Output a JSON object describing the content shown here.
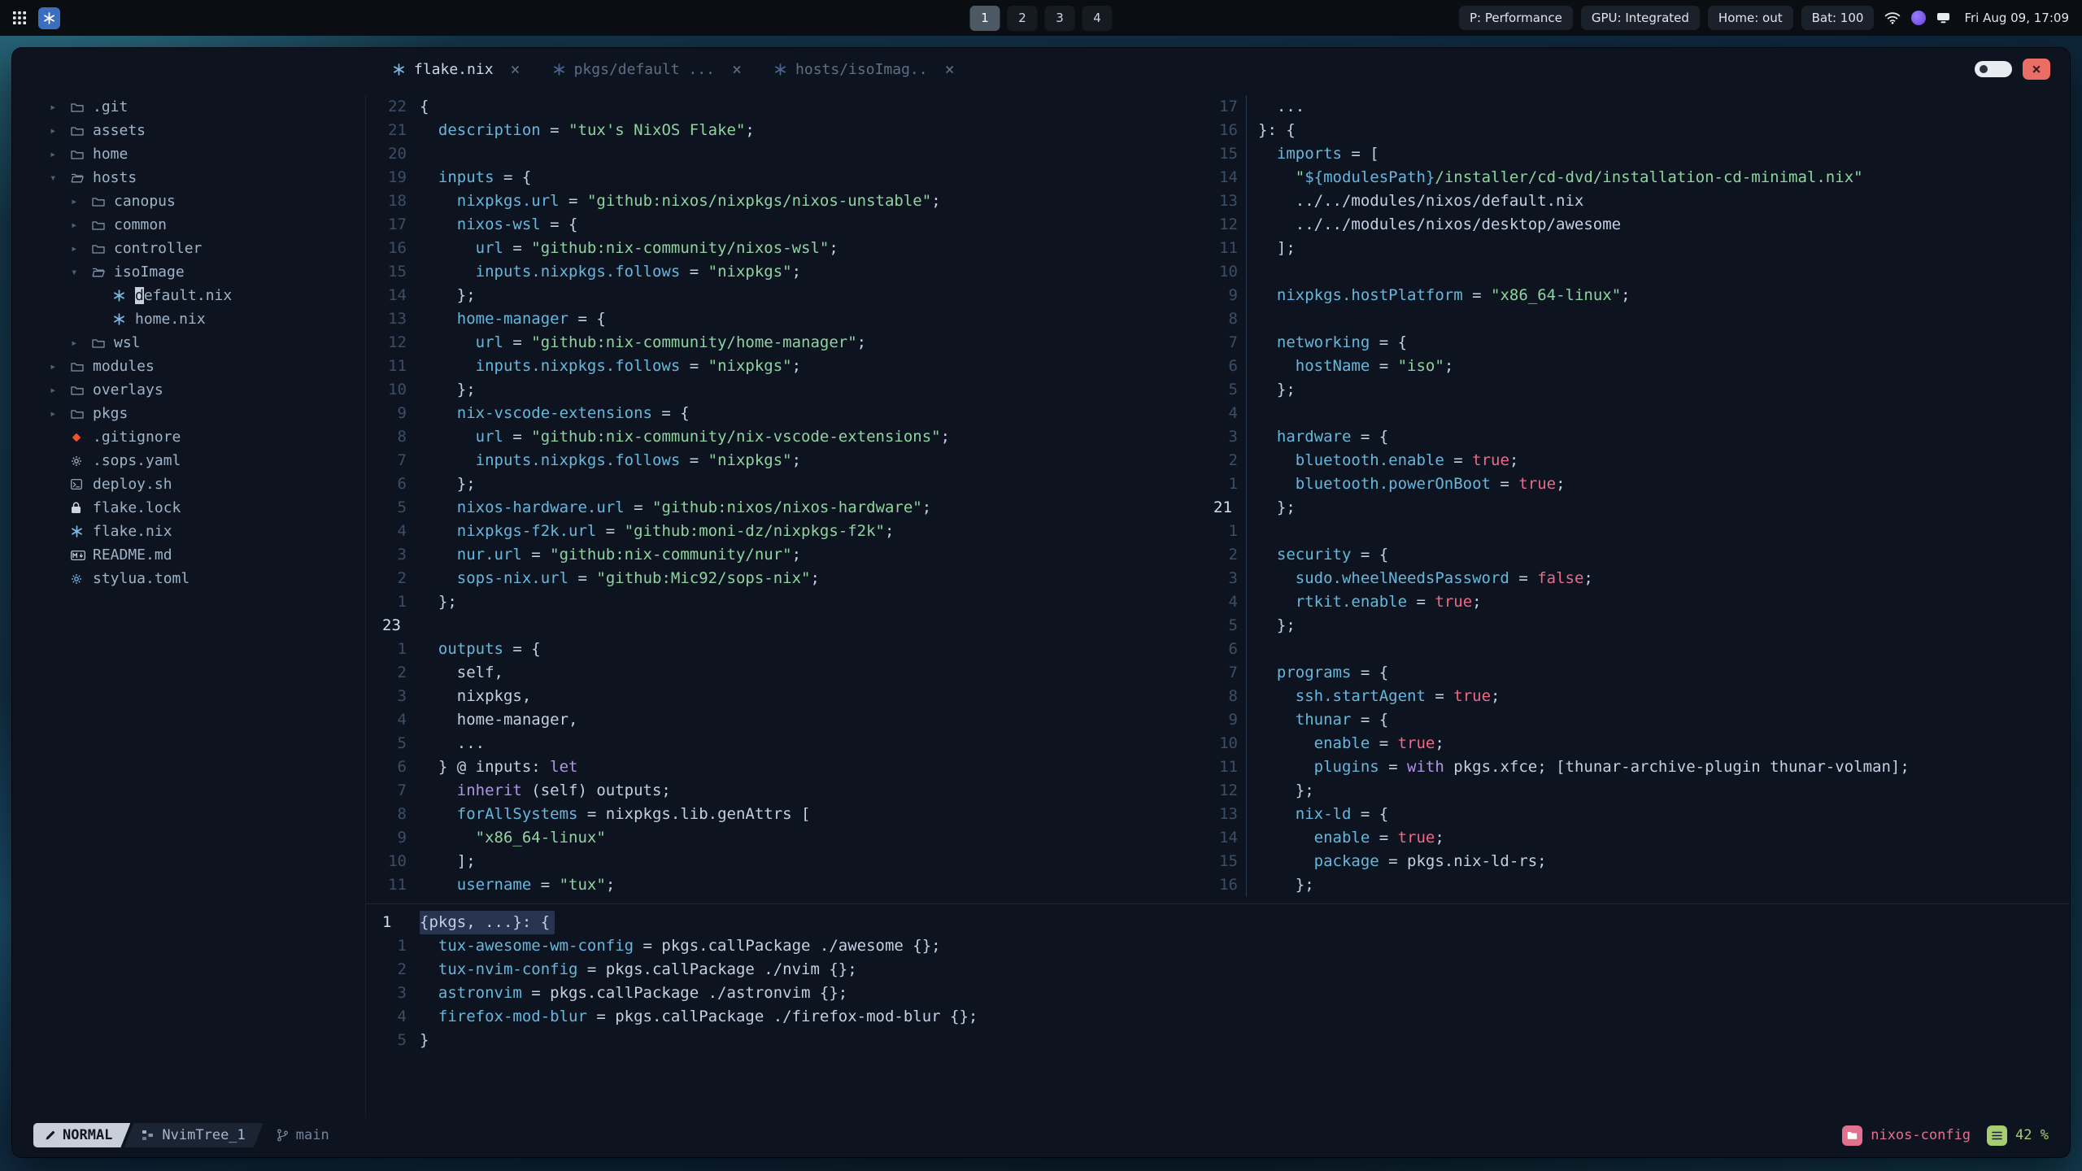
{
  "icons": {
    "chevron_right": "▸",
    "chevron_down": "▾",
    "close": "×"
  },
  "topbar": {
    "workspaces": {
      "items": [
        "1",
        "2",
        "3",
        "4"
      ],
      "active": "1"
    },
    "status_pills": [
      "P: Performance",
      "GPU: Integrated",
      "Home: out",
      "Bat: 100"
    ],
    "clock": "Fri Aug 09, 17:09"
  },
  "window": {
    "tabs": [
      {
        "label": "flake.nix",
        "active": true
      },
      {
        "label": "pkgs/default ...",
        "active": false
      },
      {
        "label": "hosts/isoImag..",
        "active": false
      }
    ],
    "tree": {
      "items": [
        {
          "depth": 0,
          "chevron": "right",
          "icon": "folder",
          "label": ".git"
        },
        {
          "depth": 0,
          "chevron": "right",
          "icon": "folder",
          "label": "assets"
        },
        {
          "depth": 0,
          "chevron": "right",
          "icon": "folder",
          "label": "home"
        },
        {
          "depth": 0,
          "chevron": "down",
          "icon": "folder-open",
          "label": "hosts"
        },
        {
          "depth": 1,
          "chevron": "right",
          "icon": "folder",
          "label": "canopus"
        },
        {
          "depth": 1,
          "chevron": "right",
          "icon": "folder",
          "label": "common"
        },
        {
          "depth": 1,
          "chevron": "right",
          "icon": "folder",
          "label": "controller"
        },
        {
          "depth": 1,
          "chevron": "down",
          "icon": "folder-open",
          "label": "isoImage"
        },
        {
          "depth": 2,
          "chevron": null,
          "icon": "nix",
          "label": "default.nix",
          "cursor": true
        },
        {
          "depth": 2,
          "chevron": null,
          "icon": "nix",
          "label": "home.nix"
        },
        {
          "depth": 1,
          "chevron": "right",
          "icon": "folder",
          "label": "wsl"
        },
        {
          "depth": 0,
          "chevron": "right",
          "icon": "folder",
          "label": "modules"
        },
        {
          "depth": 0,
          "chevron": "right",
          "icon": "folder",
          "label": "overlays"
        },
        {
          "depth": 0,
          "chevron": "right",
          "icon": "folder",
          "label": "pkgs"
        },
        {
          "depth": 0,
          "chevron": null,
          "icon": "git",
          "label": ".gitignore"
        },
        {
          "depth": 0,
          "chevron": null,
          "icon": "gear",
          "label": ".sops.yaml"
        },
        {
          "depth": 0,
          "chevron": null,
          "icon": "shell",
          "label": "deploy.sh"
        },
        {
          "depth": 0,
          "chevron": null,
          "icon": "lock",
          "label": "flake.lock"
        },
        {
          "depth": 0,
          "chevron": null,
          "icon": "nix",
          "label": "flake.nix"
        },
        {
          "depth": 0,
          "chevron": null,
          "icon": "markdown",
          "label": "README.md"
        },
        {
          "depth": 0,
          "chevron": null,
          "icon": "gear-blue",
          "label": "stylua.toml"
        }
      ]
    },
    "panes": {
      "flake": [
        {
          "n": "22",
          "t": "{"
        },
        {
          "n": "21",
          "t": "  description = \"tux's NixOS Flake\";"
        },
        {
          "n": "20",
          "t": ""
        },
        {
          "n": "19",
          "t": "  inputs = {"
        },
        {
          "n": "18",
          "t": "    nixpkgs.url = \"github:nixos/nixpkgs/nixos-unstable\";"
        },
        {
          "n": "17",
          "t": "    nixos-wsl = {"
        },
        {
          "n": "16",
          "t": "      url = \"github:nix-community/nixos-wsl\";"
        },
        {
          "n": "15",
          "t": "      inputs.nixpkgs.follows = \"nixpkgs\";"
        },
        {
          "n": "14",
          "t": "    };"
        },
        {
          "n": "13",
          "t": "    home-manager = {"
        },
        {
          "n": "12",
          "t": "      url = \"github:nix-community/home-manager\";"
        },
        {
          "n": "11",
          "t": "      inputs.nixpkgs.follows = \"nixpkgs\";"
        },
        {
          "n": "10",
          "t": "    };"
        },
        {
          "n": "9",
          "t": "    nix-vscode-extensions = {"
        },
        {
          "n": "8",
          "t": "      url = \"github:nix-community/nix-vscode-extensions\";"
        },
        {
          "n": "7",
          "t": "      inputs.nixpkgs.follows = \"nixpkgs\";"
        },
        {
          "n": "6",
          "t": "    };"
        },
        {
          "n": "5",
          "t": "    nixos-hardware.url = \"github:nixos/nixos-hardware\";"
        },
        {
          "n": "4",
          "t": "    nixpkgs-f2k.url = \"github:moni-dz/nixpkgs-f2k\";"
        },
        {
          "n": "3",
          "t": "    nur.url = \"github:nix-community/nur\";"
        },
        {
          "n": "2",
          "t": "    sops-nix.url = \"github:Mic92/sops-nix\";"
        },
        {
          "n": "1",
          "t": "  };"
        },
        {
          "n": "23",
          "t": "",
          "cur": true
        },
        {
          "n": "1",
          "t": "  outputs = {"
        },
        {
          "n": "2",
          "t": "    self,"
        },
        {
          "n": "3",
          "t": "    nixpkgs,"
        },
        {
          "n": "4",
          "t": "    home-manager,"
        },
        {
          "n": "5",
          "t": "    ..."
        },
        {
          "n": "6",
          "t": "  } @ inputs: let"
        },
        {
          "n": "7",
          "t": "    inherit (self) outputs;"
        },
        {
          "n": "8",
          "t": "    forAllSystems = nixpkgs.lib.genAttrs ["
        },
        {
          "n": "9",
          "t": "      \"x86_64-linux\""
        },
        {
          "n": "10",
          "t": "    ];"
        },
        {
          "n": "11",
          "t": "    username = \"tux\";"
        }
      ],
      "iso": [
        {
          "n": "17",
          "t": "  ..."
        },
        {
          "n": "16",
          "t": "}: {"
        },
        {
          "n": "15",
          "t": "  imports = ["
        },
        {
          "n": "14",
          "t": "    \"${modulesPath}/installer/cd-dvd/installation-cd-minimal.nix\""
        },
        {
          "n": "13",
          "t": "    ../../modules/nixos/default.nix"
        },
        {
          "n": "12",
          "t": "    ../../modules/nixos/desktop/awesome"
        },
        {
          "n": "11",
          "t": "  ];"
        },
        {
          "n": "10",
          "t": ""
        },
        {
          "n": "9",
          "t": "  nixpkgs.hostPlatform = \"x86_64-linux\";"
        },
        {
          "n": "8",
          "t": ""
        },
        {
          "n": "7",
          "t": "  networking = {"
        },
        {
          "n": "6",
          "t": "    hostName = \"iso\";"
        },
        {
          "n": "5",
          "t": "  };"
        },
        {
          "n": "4",
          "t": ""
        },
        {
          "n": "3",
          "t": "  hardware = {"
        },
        {
          "n": "2",
          "t": "    bluetooth.enable = true;"
        },
        {
          "n": "1",
          "t": "    bluetooth.powerOnBoot = true;"
        },
        {
          "n": "21",
          "t": "  };",
          "cur": true
        },
        {
          "n": "1",
          "t": ""
        },
        {
          "n": "2",
          "t": "  security = {"
        },
        {
          "n": "3",
          "t": "    sudo.wheelNeedsPassword = false;"
        },
        {
          "n": "4",
          "t": "    rtkit.enable = true;"
        },
        {
          "n": "5",
          "t": "  };"
        },
        {
          "n": "6",
          "t": ""
        },
        {
          "n": "7",
          "t": "  programs = {"
        },
        {
          "n": "8",
          "t": "    ssh.startAgent = true;"
        },
        {
          "n": "9",
          "t": "    thunar = {"
        },
        {
          "n": "10",
          "t": "      enable = true;"
        },
        {
          "n": "11",
          "t": "      plugins = with pkgs.xfce; [thunar-archive-plugin thunar-volman];"
        },
        {
          "n": "12",
          "t": "    };"
        },
        {
          "n": "13",
          "t": "    nix-ld = {"
        },
        {
          "n": "14",
          "t": "      enable = true;"
        },
        {
          "n": "15",
          "t": "      package = pkgs.nix-ld-rs;"
        },
        {
          "n": "16",
          "t": "    };"
        }
      ],
      "pkgs": [
        {
          "n": "1",
          "t": "{pkgs, ...}: {",
          "cur": true,
          "hl": true
        },
        {
          "n": "1",
          "t": "  tux-awesome-wm-config = pkgs.callPackage ./awesome {};"
        },
        {
          "n": "2",
          "t": "  tux-nvim-config = pkgs.callPackage ./nvim {};"
        },
        {
          "n": "3",
          "t": "  astronvim = pkgs.callPackage ./astronvim {};"
        },
        {
          "n": "4",
          "t": "  firefox-mod-blur = pkgs.callPackage ./firefox-mod-blur {};"
        },
        {
          "n": "5",
          "t": "}"
        }
      ]
    },
    "statusline": {
      "mode": "NORMAL",
      "buffer": "NvimTree_1",
      "branch": "main",
      "project": "nixos-config",
      "scroll": "42 %"
    }
  }
}
